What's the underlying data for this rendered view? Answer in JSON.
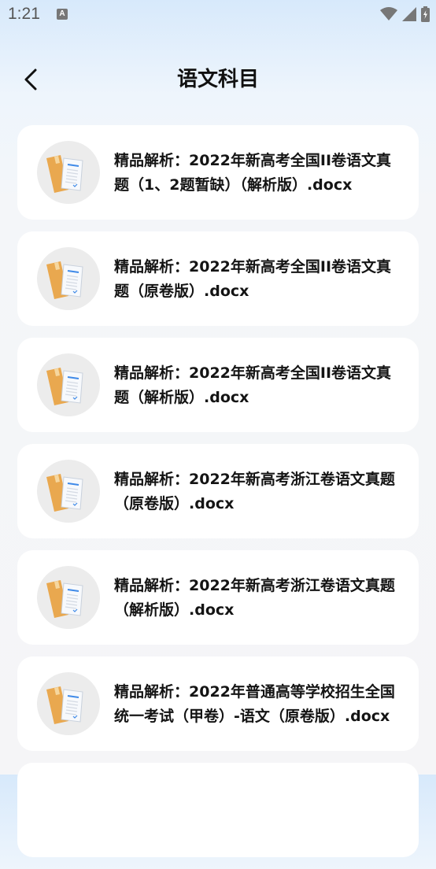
{
  "status_bar": {
    "time": "1:21",
    "notification_icon_letter": "A"
  },
  "header": {
    "title": "语文科目"
  },
  "files": [
    {
      "name": "精品解析：2022年新高考全国II卷语文真题（1、2题暂缺）（解析版）.docx"
    },
    {
      "name": "精品解析：2022年新高考全国II卷语文真题（原卷版）.docx"
    },
    {
      "name": "精品解析：2022年新高考全国II卷语文真题（解析版）.docx"
    },
    {
      "name": "精品解析：2022年新高考浙江卷语文真题（原卷版）.docx"
    },
    {
      "name": "精品解析：2022年新高考浙江卷语文真题（解析版）.docx"
    },
    {
      "name": "精品解析：2022年普通高等学校招生全国统一考试（甲卷）-语文（原卷版）.docx"
    },
    {
      "name": ""
    }
  ],
  "colors": {
    "folder": "#e9a84f",
    "page_line": "#3f8ae8",
    "card": "#ffffff",
    "icon_circle": "#ececec"
  }
}
